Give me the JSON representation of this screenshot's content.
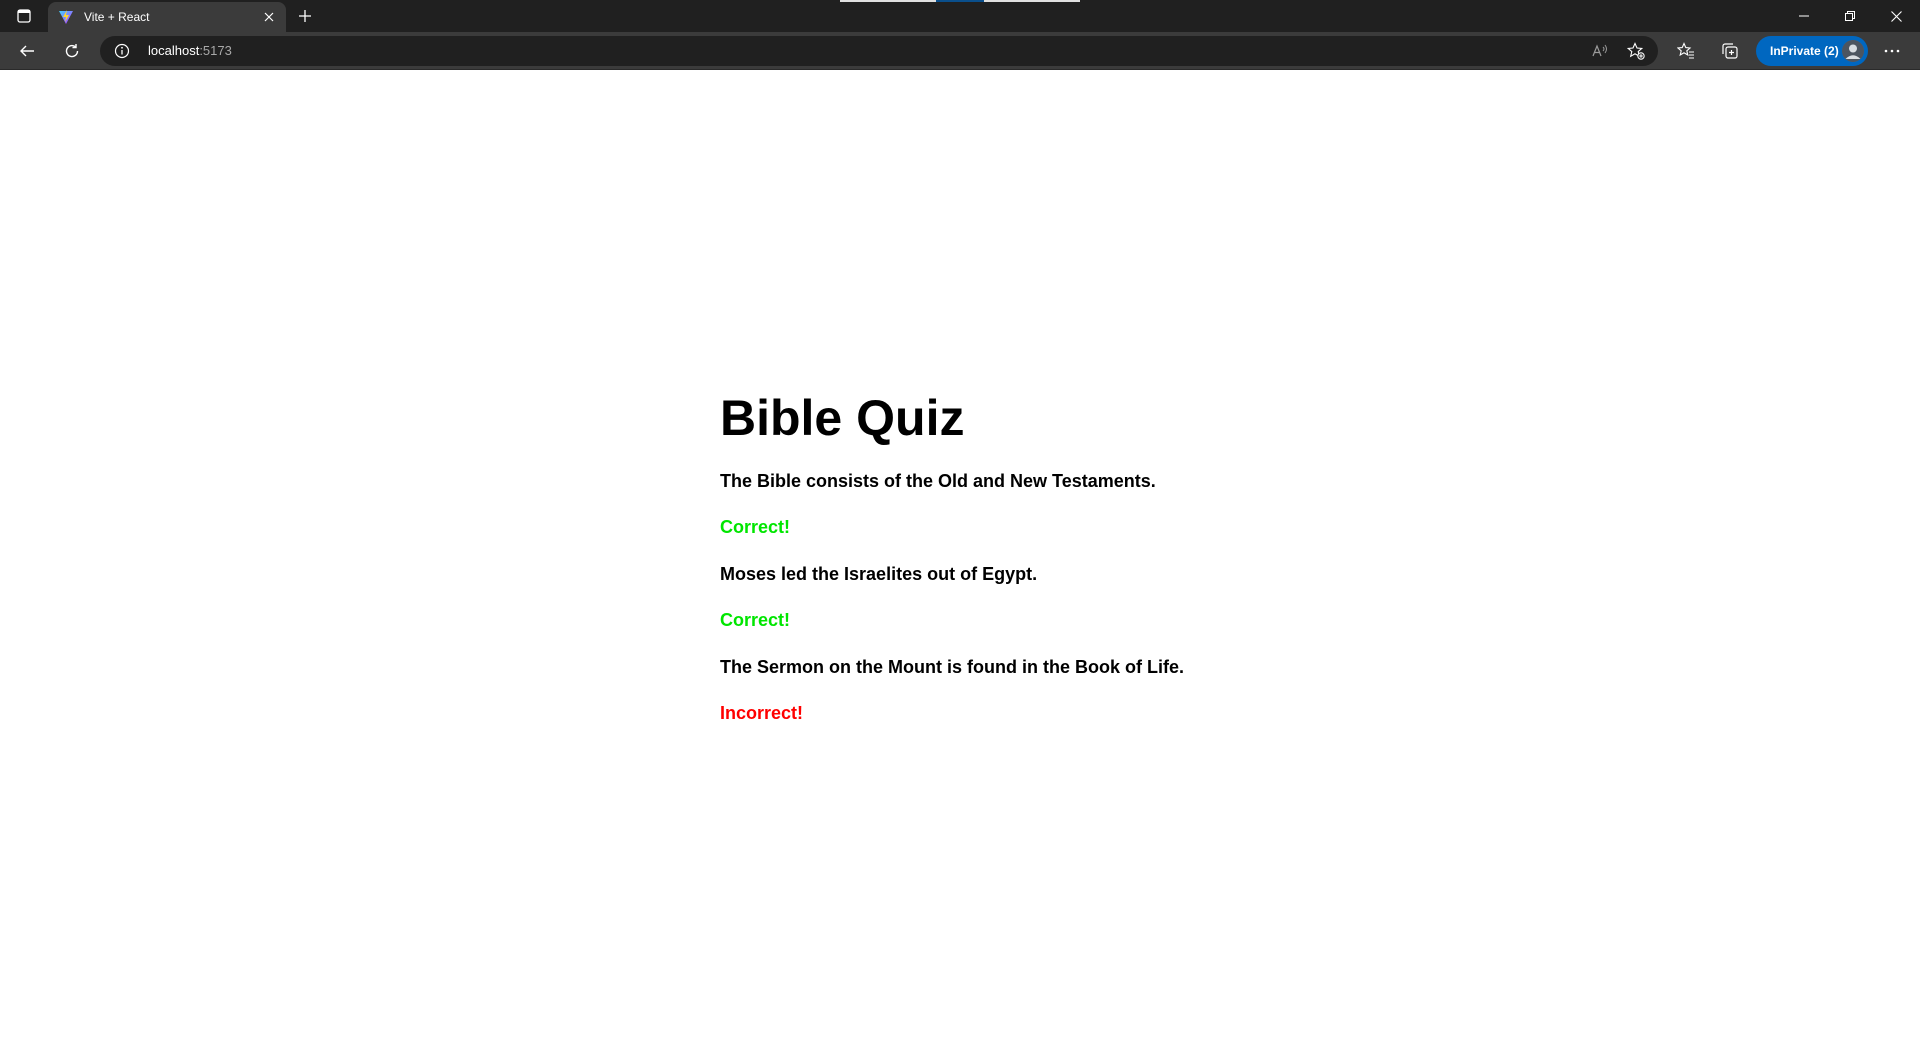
{
  "browser": {
    "tab": {
      "title": "Vite + React",
      "favicon": "vite-logo-icon"
    },
    "address": {
      "host": "localhost",
      "port": ":5173"
    },
    "inprivate_label": "InPrivate (2)"
  },
  "quiz": {
    "title": "Bible Quiz",
    "items": [
      {
        "question": "The Bible consists of the Old and New Testaments.",
        "result": "Correct!",
        "color": "#00e600"
      },
      {
        "question": "Moses led the Israelites out of Egypt.",
        "result": "Correct!",
        "color": "#00e600"
      },
      {
        "question": "The Sermon on the Mount is found in the Book of Life.",
        "result": "Incorrect!",
        "color": "#ff0000"
      }
    ]
  },
  "colors": {
    "correct": "#00e600",
    "incorrect": "#ff0000",
    "inprivate": "#0067c0"
  }
}
